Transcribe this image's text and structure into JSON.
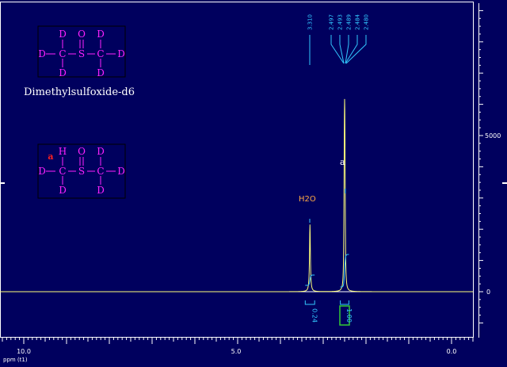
{
  "colors": {
    "background": "#00005e",
    "frame": "#ffffff",
    "spectrum": "#ffff7a",
    "integral": "#32c8ff",
    "peak_label": "#32c8ff",
    "structure": "#ff22ff",
    "highlight_atom": "#ff2020",
    "h2o_label": "#ffaa44",
    "integral_value_box": "#33cc33",
    "axis_text": "#ffffff"
  },
  "molecule_1": {
    "caption": "Dimethylsulfoxide-d6",
    "atoms": [
      "D",
      "O",
      "D",
      "D",
      "C",
      "S",
      "C",
      "D",
      "D",
      "D"
    ]
  },
  "molecule_2": {
    "marker": "a",
    "atoms": [
      "H",
      "O",
      "D",
      "D",
      "C",
      "S",
      "C",
      "D",
      "D",
      "D"
    ]
  },
  "chart_data": {
    "type": "line",
    "xlabel": "ppm (t1)",
    "x_ticks": [
      "10.0",
      "5.0",
      "0.0"
    ],
    "y_ticks": [
      "5000",
      "0"
    ],
    "xlim": [
      10.0,
      -0.5
    ],
    "ylim": [
      -1000,
      9200
    ],
    "x_reversed": true,
    "grid": false,
    "peaks": [
      {
        "ppm": 3.31,
        "height": 2150,
        "width": 0.012,
        "label": "H2O"
      },
      {
        "ppm": 2.5,
        "height": 3100,
        "width": 0.008,
        "label": "a"
      },
      {
        "ppm": 2.493,
        "height": 2400,
        "width": 0.008
      },
      {
        "ppm": 2.507,
        "height": 2100,
        "width": 0.008
      },
      {
        "ppm": 2.487,
        "height": 1000,
        "width": 0.008
      },
      {
        "ppm": 2.513,
        "height": 900,
        "width": 0.008
      }
    ],
    "peak_picks": [
      "3.310",
      "2.497",
      "2.493",
      "2.489",
      "2.484",
      "2.480"
    ],
    "integrals": [
      {
        "from": 3.42,
        "to": 3.2,
        "value": "0.24"
      },
      {
        "from": 2.6,
        "to": 2.4,
        "value": "1.00"
      }
    ]
  }
}
